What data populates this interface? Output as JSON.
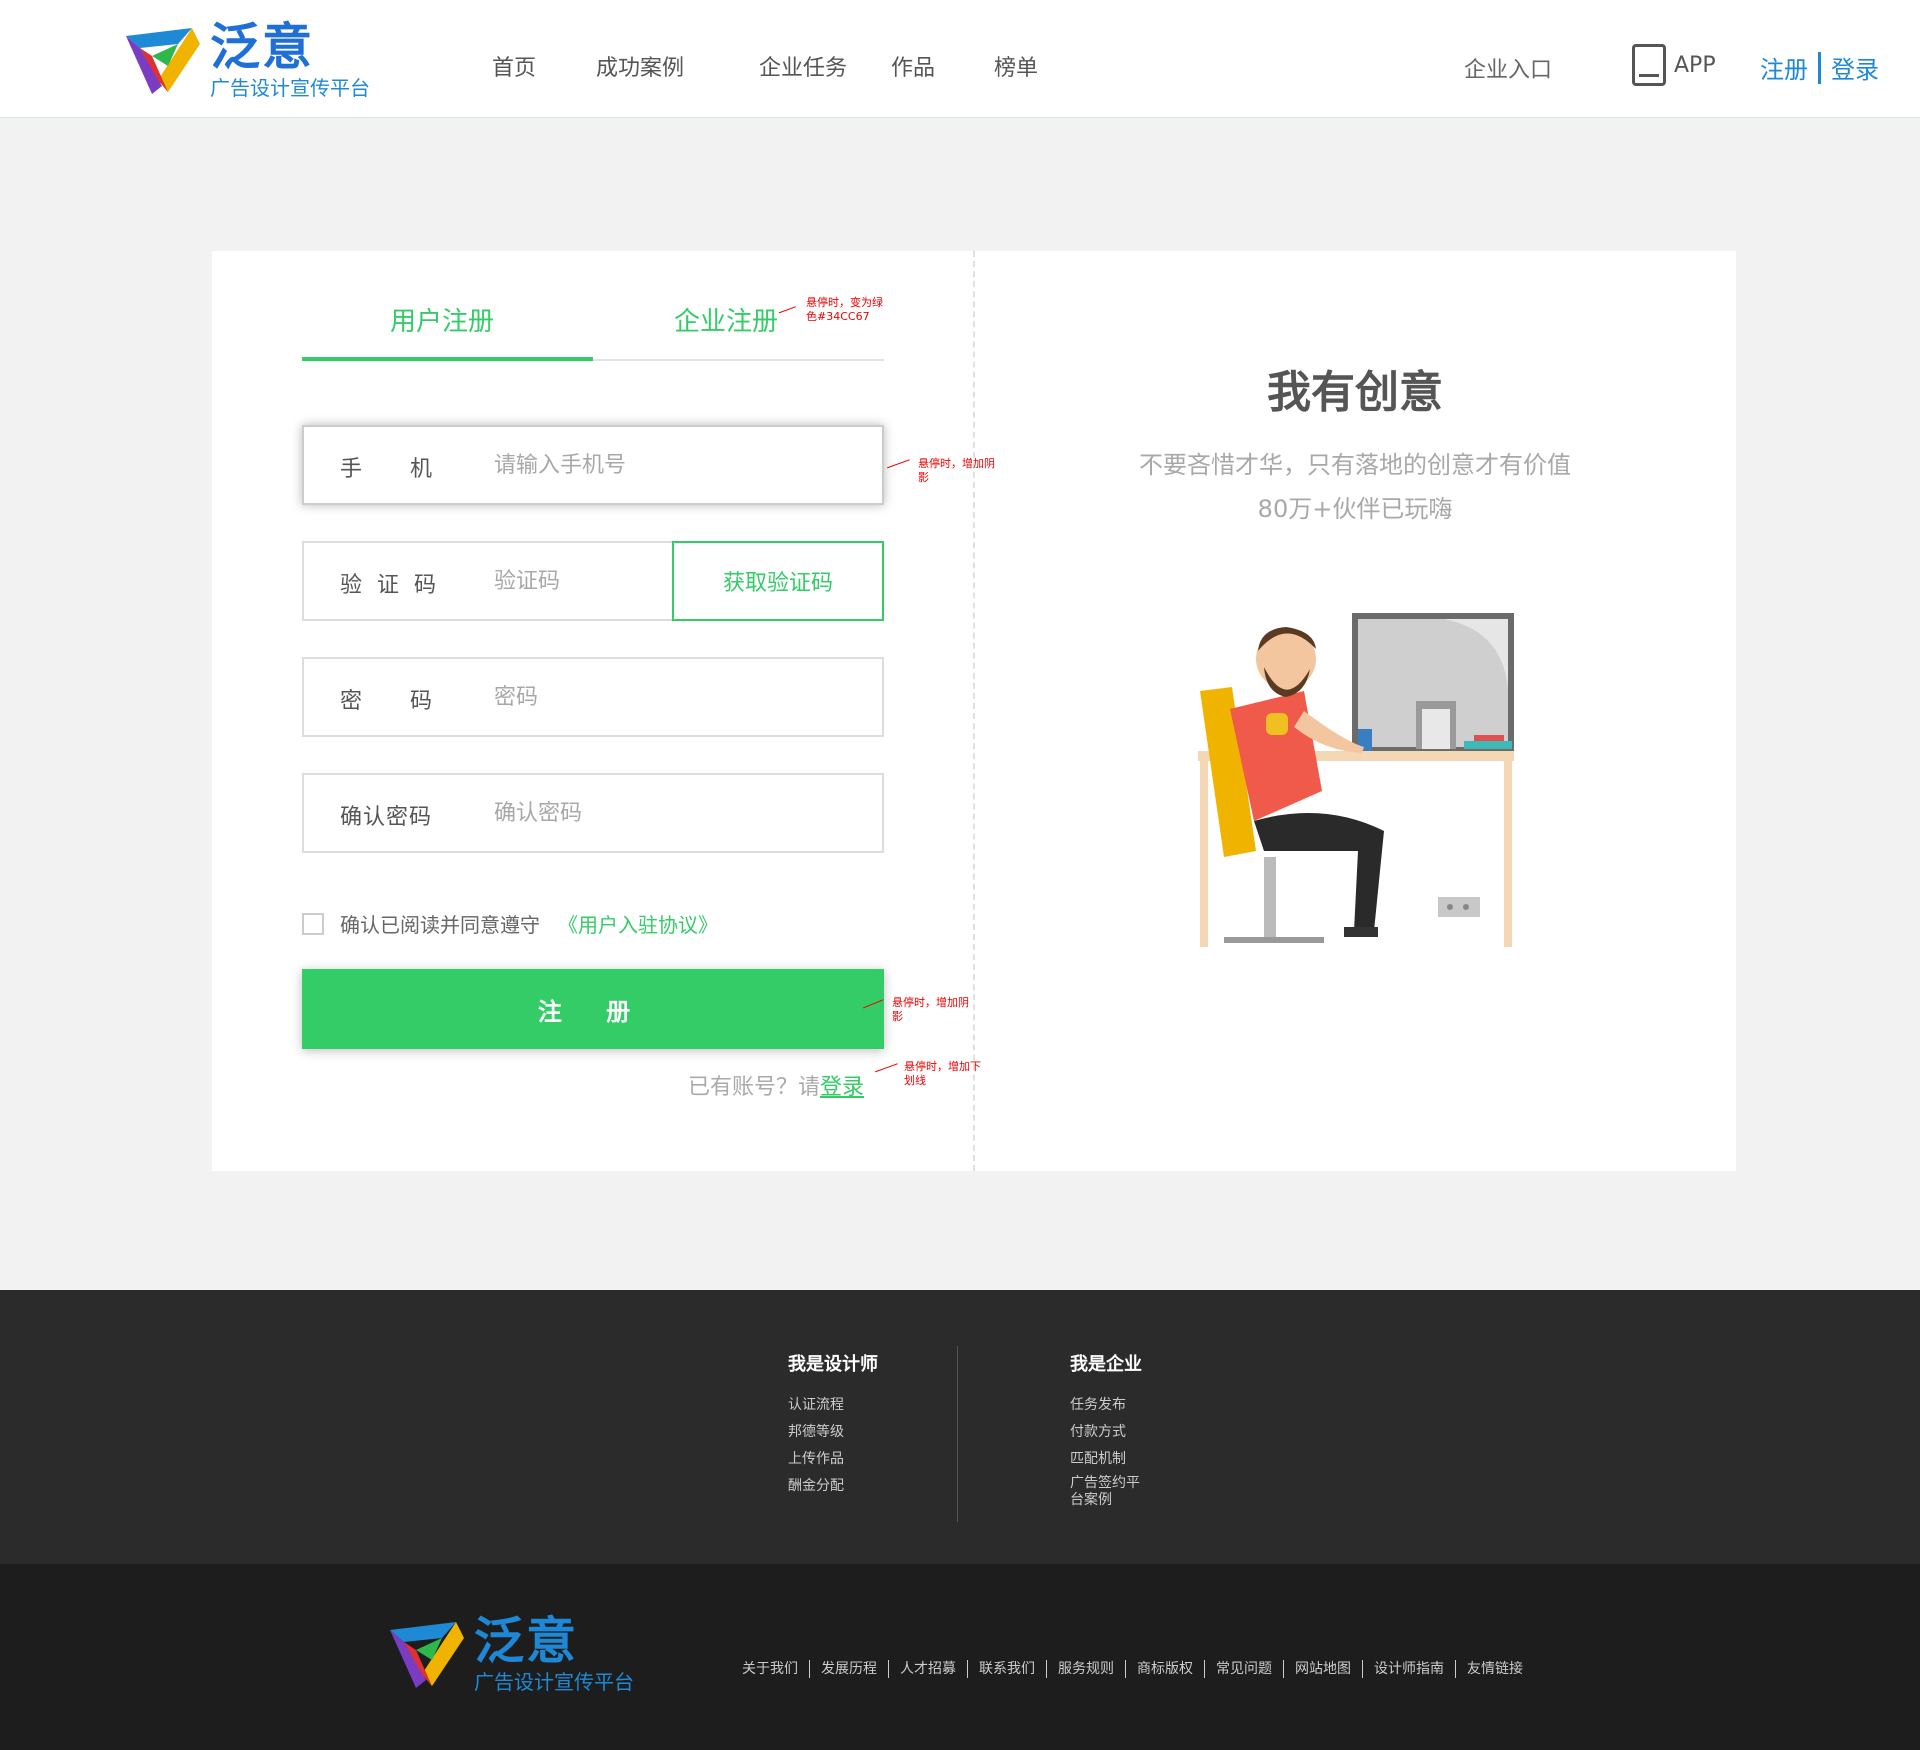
{
  "header": {
    "logo_title": "泛意",
    "logo_sub": "广告设计宣传平台",
    "nav": [
      "首页",
      "成功案例",
      "企业任务",
      "作品",
      "榜单"
    ],
    "enterprise_entry": "企业入口",
    "app_label": "APP",
    "register_link": "注册",
    "login_link": "登录"
  },
  "tabs": {
    "user": "用户注册",
    "company": "企业注册"
  },
  "form": {
    "phone": {
      "label": "手    机",
      "placeholder": "请输入手机号"
    },
    "code": {
      "label": "验 证 码",
      "placeholder": "验证码",
      "button": "获取验证码"
    },
    "password": {
      "label": "密    码",
      "placeholder": "密码"
    },
    "confirm": {
      "label": "确认密码",
      "placeholder": "确认密码"
    },
    "agree_text": "确认已阅读并同意遵守",
    "protocol_link": "《用户入驻协议》",
    "submit": "注 册",
    "login_hint": "已有账号？请",
    "login_link": "登录"
  },
  "notes": {
    "tab_hover": [
      "悬停时，变为绿",
      "色#34CC67"
    ],
    "phone_hover": [
      "悬停时，增加阴",
      "影"
    ],
    "submit_hover": [
      "悬停时，增加阴",
      "影"
    ],
    "login_hover": [
      "悬停时，增加下",
      "划线"
    ]
  },
  "hero": {
    "title": "我有创意",
    "sub1": "不要吝惜才华，只有落地的创意才有价值",
    "sub2": "80万+伙伴已玩嗨"
  },
  "footer": {
    "col1": {
      "title": "我是设计师",
      "items": [
        "认证流程",
        "邦德等级",
        "上传作品",
        "酬金分配"
      ]
    },
    "col2": {
      "title": "我是企业",
      "items": [
        "任务发布",
        "付款方式",
        "匹配机制",
        "广告签约平台案例"
      ]
    },
    "logo_title": "泛意",
    "logo_sub": "广告设计宣传平台",
    "links": [
      "关于我们",
      "发展历程",
      "人才招募",
      "联系我们",
      "服务规则",
      "商标版权",
      "常见问题",
      "网站地图",
      "设计师指南",
      "友情链接"
    ]
  },
  "colors": {
    "accent": "#34CC67",
    "brand_blue": "#1E88D6",
    "footer_top": "#2B2B2B",
    "footer_bottom": "#1D1D1D"
  }
}
